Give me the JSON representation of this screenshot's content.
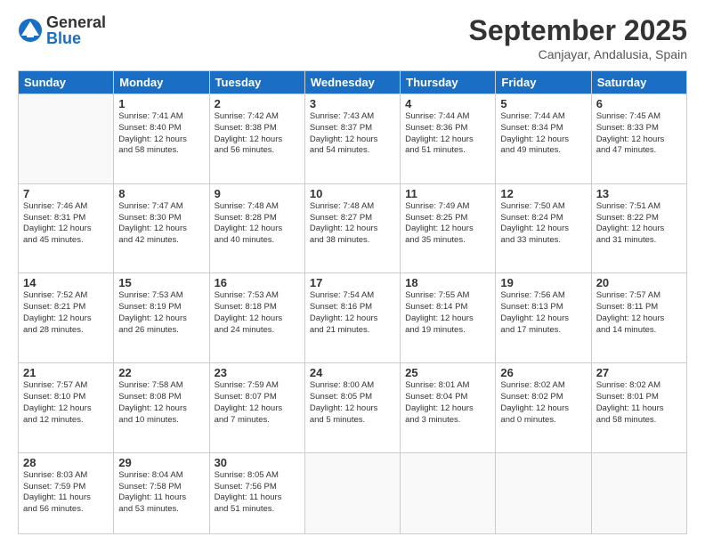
{
  "logo": {
    "general": "General",
    "blue": "Blue"
  },
  "title": {
    "month": "September 2025",
    "location": "Canjayar, Andalusia, Spain"
  },
  "headers": [
    "Sunday",
    "Monday",
    "Tuesday",
    "Wednesday",
    "Thursday",
    "Friday",
    "Saturday"
  ],
  "weeks": [
    [
      {
        "day": "",
        "info": ""
      },
      {
        "day": "1",
        "info": "Sunrise: 7:41 AM\nSunset: 8:40 PM\nDaylight: 12 hours\nand 58 minutes."
      },
      {
        "day": "2",
        "info": "Sunrise: 7:42 AM\nSunset: 8:38 PM\nDaylight: 12 hours\nand 56 minutes."
      },
      {
        "day": "3",
        "info": "Sunrise: 7:43 AM\nSunset: 8:37 PM\nDaylight: 12 hours\nand 54 minutes."
      },
      {
        "day": "4",
        "info": "Sunrise: 7:44 AM\nSunset: 8:36 PM\nDaylight: 12 hours\nand 51 minutes."
      },
      {
        "day": "5",
        "info": "Sunrise: 7:44 AM\nSunset: 8:34 PM\nDaylight: 12 hours\nand 49 minutes."
      },
      {
        "day": "6",
        "info": "Sunrise: 7:45 AM\nSunset: 8:33 PM\nDaylight: 12 hours\nand 47 minutes."
      }
    ],
    [
      {
        "day": "7",
        "info": "Sunrise: 7:46 AM\nSunset: 8:31 PM\nDaylight: 12 hours\nand 45 minutes."
      },
      {
        "day": "8",
        "info": "Sunrise: 7:47 AM\nSunset: 8:30 PM\nDaylight: 12 hours\nand 42 minutes."
      },
      {
        "day": "9",
        "info": "Sunrise: 7:48 AM\nSunset: 8:28 PM\nDaylight: 12 hours\nand 40 minutes."
      },
      {
        "day": "10",
        "info": "Sunrise: 7:48 AM\nSunset: 8:27 PM\nDaylight: 12 hours\nand 38 minutes."
      },
      {
        "day": "11",
        "info": "Sunrise: 7:49 AM\nSunset: 8:25 PM\nDaylight: 12 hours\nand 35 minutes."
      },
      {
        "day": "12",
        "info": "Sunrise: 7:50 AM\nSunset: 8:24 PM\nDaylight: 12 hours\nand 33 minutes."
      },
      {
        "day": "13",
        "info": "Sunrise: 7:51 AM\nSunset: 8:22 PM\nDaylight: 12 hours\nand 31 minutes."
      }
    ],
    [
      {
        "day": "14",
        "info": "Sunrise: 7:52 AM\nSunset: 8:21 PM\nDaylight: 12 hours\nand 28 minutes."
      },
      {
        "day": "15",
        "info": "Sunrise: 7:53 AM\nSunset: 8:19 PM\nDaylight: 12 hours\nand 26 minutes."
      },
      {
        "day": "16",
        "info": "Sunrise: 7:53 AM\nSunset: 8:18 PM\nDaylight: 12 hours\nand 24 minutes."
      },
      {
        "day": "17",
        "info": "Sunrise: 7:54 AM\nSunset: 8:16 PM\nDaylight: 12 hours\nand 21 minutes."
      },
      {
        "day": "18",
        "info": "Sunrise: 7:55 AM\nSunset: 8:14 PM\nDaylight: 12 hours\nand 19 minutes."
      },
      {
        "day": "19",
        "info": "Sunrise: 7:56 AM\nSunset: 8:13 PM\nDaylight: 12 hours\nand 17 minutes."
      },
      {
        "day": "20",
        "info": "Sunrise: 7:57 AM\nSunset: 8:11 PM\nDaylight: 12 hours\nand 14 minutes."
      }
    ],
    [
      {
        "day": "21",
        "info": "Sunrise: 7:57 AM\nSunset: 8:10 PM\nDaylight: 12 hours\nand 12 minutes."
      },
      {
        "day": "22",
        "info": "Sunrise: 7:58 AM\nSunset: 8:08 PM\nDaylight: 12 hours\nand 10 minutes."
      },
      {
        "day": "23",
        "info": "Sunrise: 7:59 AM\nSunset: 8:07 PM\nDaylight: 12 hours\nand 7 minutes."
      },
      {
        "day": "24",
        "info": "Sunrise: 8:00 AM\nSunset: 8:05 PM\nDaylight: 12 hours\nand 5 minutes."
      },
      {
        "day": "25",
        "info": "Sunrise: 8:01 AM\nSunset: 8:04 PM\nDaylight: 12 hours\nand 3 minutes."
      },
      {
        "day": "26",
        "info": "Sunrise: 8:02 AM\nSunset: 8:02 PM\nDaylight: 12 hours\nand 0 minutes."
      },
      {
        "day": "27",
        "info": "Sunrise: 8:02 AM\nSunset: 8:01 PM\nDaylight: 11 hours\nand 58 minutes."
      }
    ],
    [
      {
        "day": "28",
        "info": "Sunrise: 8:03 AM\nSunset: 7:59 PM\nDaylight: 11 hours\nand 56 minutes."
      },
      {
        "day": "29",
        "info": "Sunrise: 8:04 AM\nSunset: 7:58 PM\nDaylight: 11 hours\nand 53 minutes."
      },
      {
        "day": "30",
        "info": "Sunrise: 8:05 AM\nSunset: 7:56 PM\nDaylight: 11 hours\nand 51 minutes."
      },
      {
        "day": "",
        "info": ""
      },
      {
        "day": "",
        "info": ""
      },
      {
        "day": "",
        "info": ""
      },
      {
        "day": "",
        "info": ""
      }
    ]
  ]
}
